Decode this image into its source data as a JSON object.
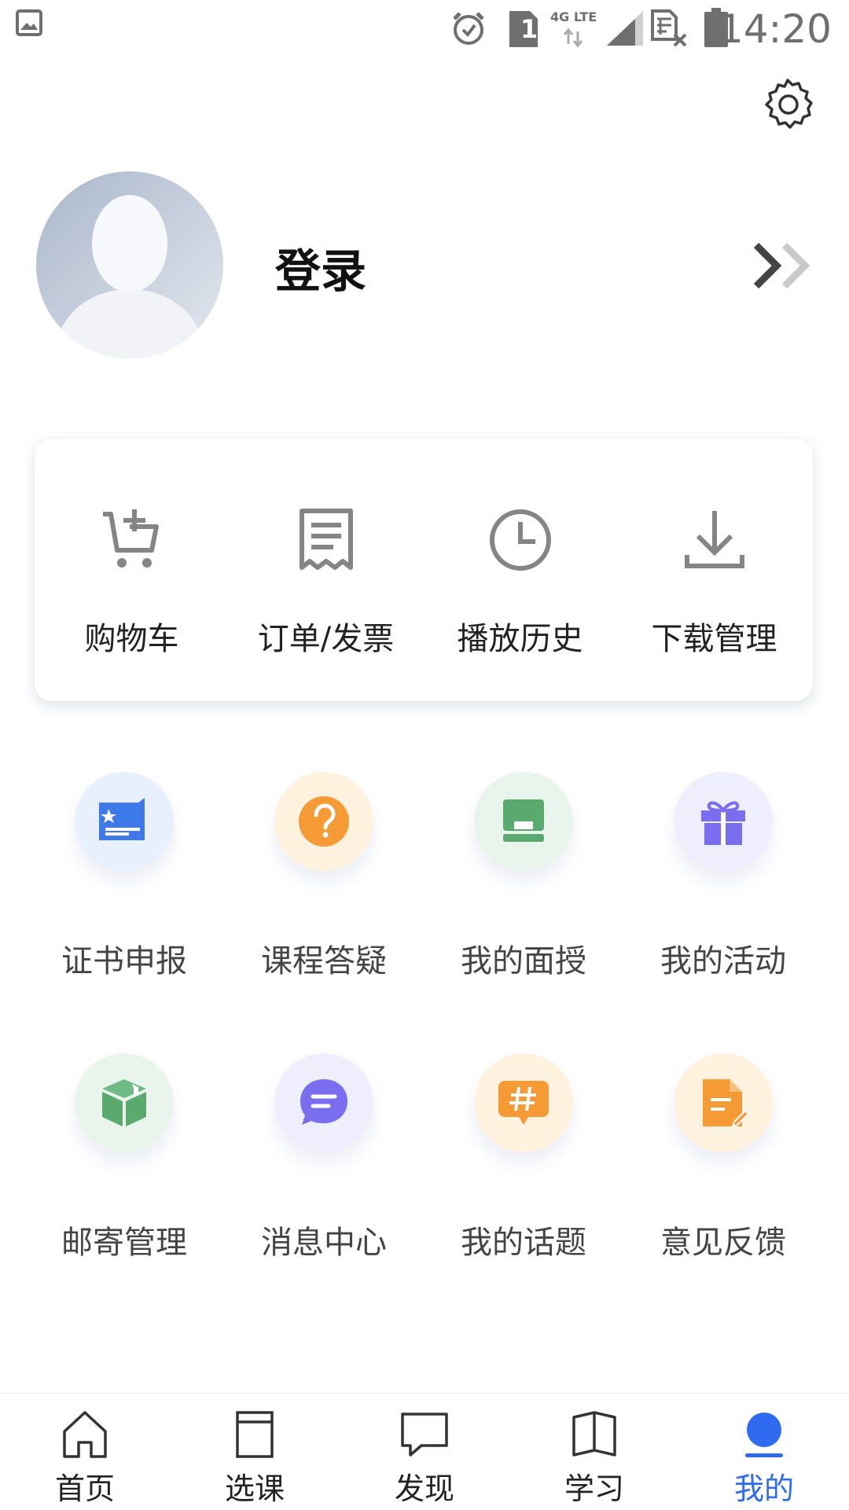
{
  "status_bar": {
    "time": "14:20",
    "network": "4G LTE",
    "sim": "1"
  },
  "profile": {
    "login_label": "登录"
  },
  "card": {
    "items": [
      {
        "label": "购物车",
        "icon": "cart-plus-icon"
      },
      {
        "label": "订单/发票",
        "icon": "receipt-icon"
      },
      {
        "label": "播放历史",
        "icon": "clock-icon"
      },
      {
        "label": "下载管理",
        "icon": "download-icon"
      }
    ]
  },
  "grid": {
    "items": [
      {
        "label": "证书申报",
        "icon": "certificate-icon",
        "bg": "#e9f0fd",
        "color": "#3e79ea"
      },
      {
        "label": "课程答疑",
        "icon": "question-icon",
        "bg": "#fff3e0",
        "color": "#f59a35"
      },
      {
        "label": "我的面授",
        "icon": "classroom-icon",
        "bg": "#e8f4ec",
        "color": "#5aa96f"
      },
      {
        "label": "我的活动",
        "icon": "gift-icon",
        "bg": "#eeeefc",
        "color": "#7b6df0"
      },
      {
        "label": "邮寄管理",
        "icon": "package-icon",
        "bg": "#e8f4ec",
        "color": "#5aa96f"
      },
      {
        "label": "消息中心",
        "icon": "message-icon",
        "bg": "#eeeefc",
        "color": "#7b6df0"
      },
      {
        "label": "我的话题",
        "icon": "topic-icon",
        "bg": "#fff3e0",
        "color": "#f59a35"
      },
      {
        "label": "意见反馈",
        "icon": "feedback-icon",
        "bg": "#fff3e0",
        "color": "#f59a35"
      }
    ]
  },
  "tabbar": {
    "tabs": [
      {
        "label": "首页",
        "icon": "home-icon"
      },
      {
        "label": "选课",
        "icon": "course-icon"
      },
      {
        "label": "发现",
        "icon": "discover-icon"
      },
      {
        "label": "学习",
        "icon": "study-book-icon"
      },
      {
        "label": "我的",
        "icon": "me-icon",
        "active": true
      }
    ],
    "active_color": "#2f6bf1"
  }
}
